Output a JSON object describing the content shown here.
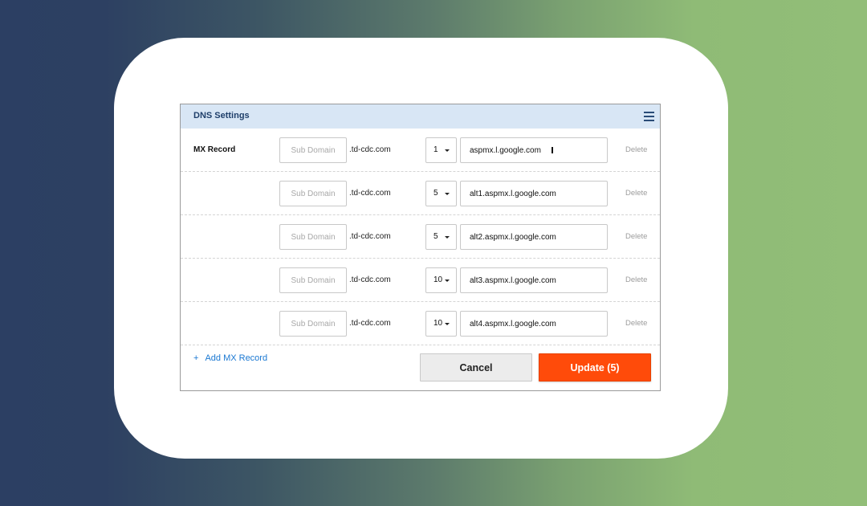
{
  "dns_settings": {
    "title": "DNS Settings",
    "menu_icon": "hamburger-menu-icon",
    "section_label": "MX Record",
    "subdomain_placeholder": "Sub Domain",
    "domain_suffix": ".td-cdc.com",
    "delete_label": "Delete",
    "records": [
      {
        "priority": "1",
        "host": "aspmx.l.google.com"
      },
      {
        "priority": "5",
        "host": "alt1.aspmx.l.google.com"
      },
      {
        "priority": "5",
        "host": "alt2.aspmx.l.google.com"
      },
      {
        "priority": "10",
        "host": "alt3.aspmx.l.google.com"
      },
      {
        "priority": "10",
        "host": "alt4.aspmx.l.google.com"
      }
    ],
    "add_record": {
      "icon": "+",
      "label": "Add MX Record"
    },
    "cancel_label": "Cancel",
    "update_label": "Update (5)"
  },
  "colors": {
    "header_background": "#d8e6f5",
    "link": "#1a78d2",
    "update_button": "#ff4b0a"
  }
}
